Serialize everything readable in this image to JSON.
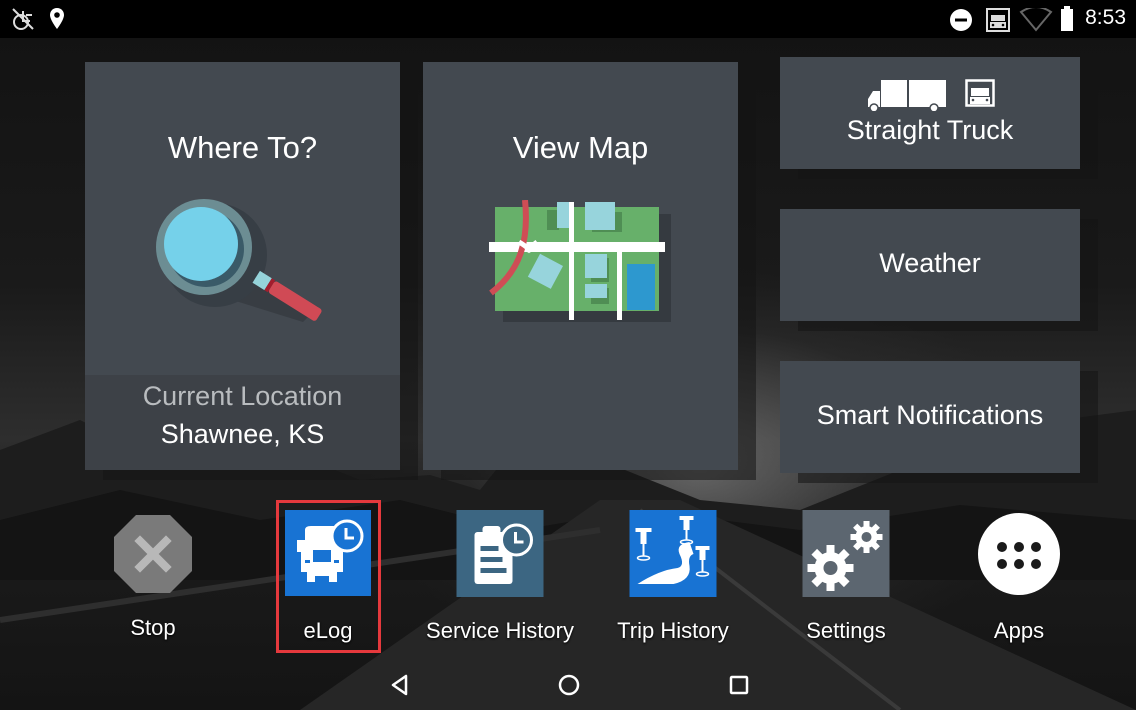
{
  "status_bar": {
    "left_icons": [
      "wheelchair-off-icon",
      "location-pin-icon"
    ],
    "right_icons": [
      "do-not-disturb-icon",
      "truck-mode-icon",
      "wifi-icon",
      "battery-icon"
    ],
    "time": "8:53"
  },
  "tiles": {
    "where_to": {
      "title": "Where To?",
      "icon": "magnifier-icon",
      "current_location_caption": "Current Location",
      "current_location_value": "Shawnee, KS"
    },
    "view_map": {
      "title": "View Map",
      "icon": "map-icon"
    },
    "vehicle_profile": {
      "label": "Straight Truck",
      "icons": [
        "straight-truck-side-icon",
        "truck-front-icon"
      ]
    },
    "weather": {
      "label": "Weather"
    },
    "smart_notifications": {
      "label": "Smart Notifications"
    }
  },
  "dock": {
    "items": [
      {
        "label": "Stop",
        "icon": "stop-octagon-icon"
      },
      {
        "label": "eLog",
        "icon": "elog-truck-clock-icon",
        "highlighted": true
      },
      {
        "label": "Service History",
        "icon": "clipboard-clock-icon"
      },
      {
        "label": "Trip History",
        "icon": "trip-pins-icon"
      },
      {
        "label": "Settings",
        "icon": "gears-icon"
      },
      {
        "label": "Apps",
        "icon": "apps-grid-icon"
      }
    ],
    "highlight_color": "#e5393d"
  },
  "nav_bar": {
    "buttons": [
      "back",
      "home",
      "recents"
    ]
  },
  "colors": {
    "tile": "#434950",
    "elog_blue": "#1873d3",
    "service_history_teal": "#3c6682",
    "settings_gray": "#5c6670",
    "stop_gray": "#7a7a7a"
  }
}
